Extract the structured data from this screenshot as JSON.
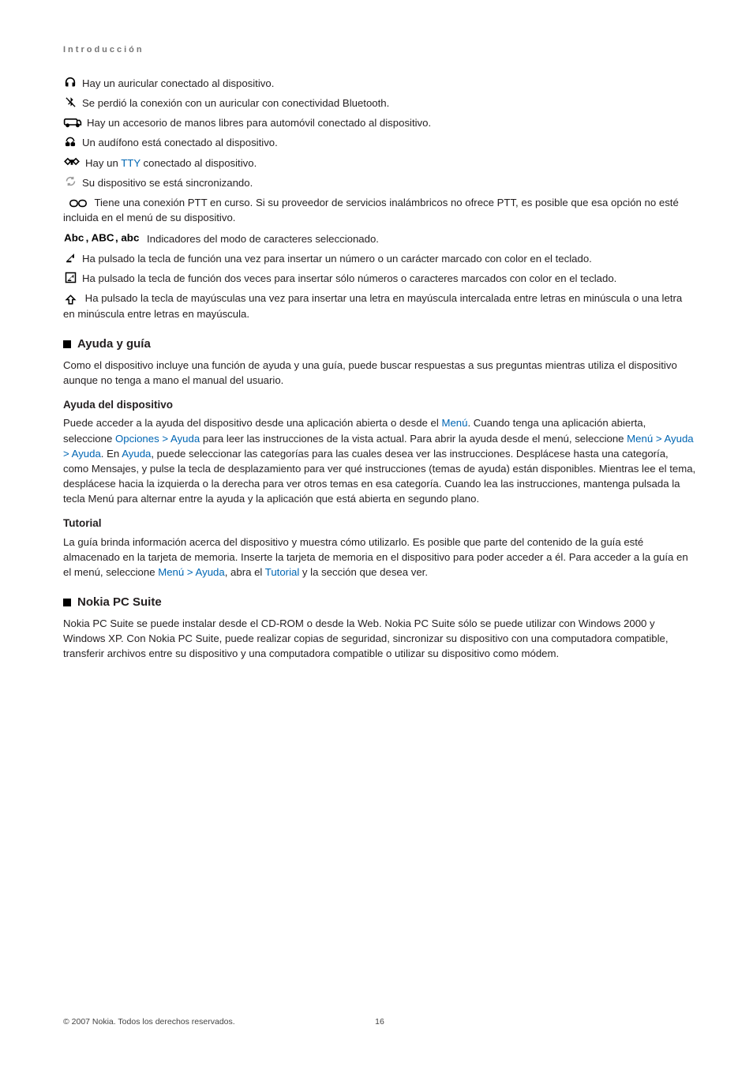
{
  "running_head": "Introducción",
  "icons": {
    "headset": {
      "text": "Hay un auricular conectado al dispositivo."
    },
    "bt_lost": {
      "text": "Se perdió la conexión con un auricular con conectividad Bluetooth."
    },
    "car_kit": {
      "text": "Hay un accesorio de manos libres para automóvil conectado al dispositivo."
    },
    "loopset": {
      "text": "Un audífono está conectado al dispositivo."
    },
    "tty": {
      "pre": "Hay un ",
      "link": "TTY",
      "post": " conectado al dispositivo."
    },
    "sync": {
      "text": "Su dispositivo se está sincronizando."
    },
    "ptt": {
      "text": "Tiene una conexión PTT en curso. Si su proveedor de servicios inalámbricos no ofrece PTT, es posible que esa opción no esté incluida en el menú de su dispositivo."
    },
    "abc": {
      "text": "Indicadores del modo de caracteres seleccionado."
    },
    "fn_once": {
      "text": "Ha pulsado la tecla de función una vez para insertar un número o un carácter marcado con color en el teclado."
    },
    "fn_twice": {
      "text": "Ha pulsado la tecla de función dos veces para insertar sólo números o caracteres marcados con color en el teclado."
    },
    "shift": {
      "text": "Ha pulsado la tecla de mayúsculas una vez para insertar una letra en mayúscula intercalada entre letras en minúscula o una letra en minúscula entre letras en mayúscula."
    }
  },
  "sections": {
    "ayuda": {
      "title": "Ayuda y guía",
      "intro": "Como el dispositivo incluye una función de ayuda y una guía, puede buscar respuestas a sus preguntas mientras utiliza el dispositivo aunque no tenga a mano el manual del usuario.",
      "h1": "Ayuda del dispositivo",
      "p1_pre": "Puede acceder a la ayuda del dispositivo desde una aplicación abierta o desde el ",
      "p1_menu": "Menú",
      "p1_mid": ". Cuando tenga una aplicación abierta, seleccione ",
      "p1_opciones": "Opciones",
      "p1_ayuda": "Ayuda",
      "p1_post": " para leer las instrucciones de la vista actual.",
      "p2_pre": "Para abrir la ayuda desde el menú, seleccione ",
      "p2_menu": "Menú",
      "p2_ayuda1": "Ayuda",
      "p2_ayuda2": "Ayuda",
      "p2_en": ". En ",
      "p2_ayuda3": "Ayuda",
      "p2_post": ", puede seleccionar las categorías para las cuales desea ver las instrucciones. Desplácese hasta una categoría, como Mensajes, y pulse la tecla de desplazamiento para ver qué instrucciones (temas de ayuda) están disponibles. Mientras lee el tema, desplácese hacia la izquierda o la derecha para ver otros temas en esa categoría.",
      "p3": "Cuando lea las instrucciones, mantenga pulsada la tecla Menú para alternar entre la ayuda y la aplicación que está abierta en segundo plano.",
      "h2": "Tutorial",
      "t1": "La guía brinda información acerca del dispositivo y muestra cómo utilizarlo. Es posible que parte del contenido de la guía esté almacenado en la tarjeta de memoria. Inserte la tarjeta de memoria en el dispositivo para poder acceder a él.",
      "t2_pre": "Para acceder a la guía en el menú, seleccione ",
      "t2_menu": "Menú",
      "t2_ayuda": "Ayuda",
      "t2_mid": ", abra el ",
      "t2_tut": "Tutorial",
      "t2_post": " y la sección que desea ver."
    },
    "pcsuite": {
      "title": "Nokia PC Suite",
      "p1": "Nokia PC Suite se puede instalar desde el CD-ROM o desde la Web. Nokia PC Suite sólo se puede utilizar con Windows 2000 y Windows XP. Con Nokia PC Suite, puede realizar copias de seguridad, sincronizar su dispositivo con una computadora compatible, transferir archivos entre su dispositivo y una computadora compatible o utilizar su dispositivo como módem."
    }
  },
  "footer": {
    "copy": "© 2007 Nokia. Todos los derechos reservados.",
    "page": "16"
  },
  "gt": ">"
}
